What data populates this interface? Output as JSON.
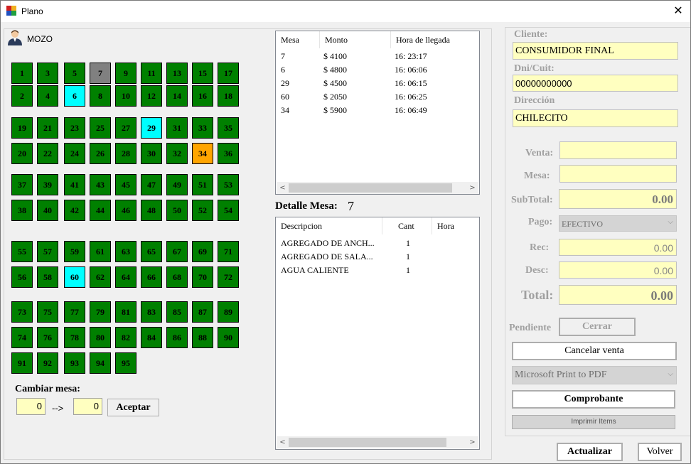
{
  "window": {
    "title": "Plano",
    "close_glyph": "✕",
    "icon": "app-icon"
  },
  "mozo": {
    "label": "MOZO",
    "icon": "waiter-avatar-icon"
  },
  "tables": [
    {
      "n": "1",
      "s": "g"
    },
    {
      "n": "3",
      "s": "g"
    },
    {
      "n": "5",
      "s": "g"
    },
    {
      "n": "7",
      "s": "x"
    },
    {
      "n": "9",
      "s": "g"
    },
    {
      "n": "11",
      "s": "g"
    },
    {
      "n": "13",
      "s": "g"
    },
    {
      "n": "15",
      "s": "g"
    },
    {
      "n": "17",
      "s": "g"
    },
    {
      "n": "2",
      "s": "g"
    },
    {
      "n": "4",
      "s": "g"
    },
    {
      "n": "6",
      "s": "c"
    },
    {
      "n": "8",
      "s": "g"
    },
    {
      "n": "10",
      "s": "g"
    },
    {
      "n": "12",
      "s": "g"
    },
    {
      "n": "14",
      "s": "g"
    },
    {
      "n": "16",
      "s": "g"
    },
    {
      "n": "18",
      "s": "g"
    },
    {
      "n": "19",
      "s": "g"
    },
    {
      "n": "21",
      "s": "g"
    },
    {
      "n": "23",
      "s": "g"
    },
    {
      "n": "25",
      "s": "g"
    },
    {
      "n": "27",
      "s": "g"
    },
    {
      "n": "29",
      "s": "c"
    },
    {
      "n": "31",
      "s": "g"
    },
    {
      "n": "33",
      "s": "g"
    },
    {
      "n": "35",
      "s": "g"
    },
    {
      "n": "20",
      "s": "g"
    },
    {
      "n": "22",
      "s": "g"
    },
    {
      "n": "24",
      "s": "g"
    },
    {
      "n": "26",
      "s": "g"
    },
    {
      "n": "28",
      "s": "g"
    },
    {
      "n": "30",
      "s": "g"
    },
    {
      "n": "32",
      "s": "g"
    },
    {
      "n": "34",
      "s": "o"
    },
    {
      "n": "36",
      "s": "g"
    },
    {
      "n": "37",
      "s": "g"
    },
    {
      "n": "39",
      "s": "g"
    },
    {
      "n": "41",
      "s": "g"
    },
    {
      "n": "43",
      "s": "g"
    },
    {
      "n": "45",
      "s": "g"
    },
    {
      "n": "47",
      "s": "g"
    },
    {
      "n": "49",
      "s": "g"
    },
    {
      "n": "51",
      "s": "g"
    },
    {
      "n": "53",
      "s": "g"
    },
    {
      "n": "38",
      "s": "g"
    },
    {
      "n": "40",
      "s": "g"
    },
    {
      "n": "42",
      "s": "g"
    },
    {
      "n": "44",
      "s": "g"
    },
    {
      "n": "46",
      "s": "g"
    },
    {
      "n": "48",
      "s": "g"
    },
    {
      "n": "50",
      "s": "g"
    },
    {
      "n": "52",
      "s": "g"
    },
    {
      "n": "54",
      "s": "g"
    },
    {
      "n": "55",
      "s": "g"
    },
    {
      "n": "57",
      "s": "g"
    },
    {
      "n": "59",
      "s": "g"
    },
    {
      "n": "61",
      "s": "g"
    },
    {
      "n": "63",
      "s": "g"
    },
    {
      "n": "65",
      "s": "g"
    },
    {
      "n": "67",
      "s": "g"
    },
    {
      "n": "69",
      "s": "g"
    },
    {
      "n": "71",
      "s": "g"
    },
    {
      "n": "56",
      "s": "g"
    },
    {
      "n": "58",
      "s": "g"
    },
    {
      "n": "60",
      "s": "c"
    },
    {
      "n": "62",
      "s": "g"
    },
    {
      "n": "64",
      "s": "g"
    },
    {
      "n": "66",
      "s": "g"
    },
    {
      "n": "68",
      "s": "g"
    },
    {
      "n": "70",
      "s": "g"
    },
    {
      "n": "72",
      "s": "g"
    },
    {
      "n": "73",
      "s": "g"
    },
    {
      "n": "75",
      "s": "g"
    },
    {
      "n": "77",
      "s": "g"
    },
    {
      "n": "79",
      "s": "g"
    },
    {
      "n": "81",
      "s": "g"
    },
    {
      "n": "83",
      "s": "g"
    },
    {
      "n": "85",
      "s": "g"
    },
    {
      "n": "87",
      "s": "g"
    },
    {
      "n": "89",
      "s": "g"
    },
    {
      "n": "74",
      "s": "g"
    },
    {
      "n": "76",
      "s": "g"
    },
    {
      "n": "78",
      "s": "g"
    },
    {
      "n": "80",
      "s": "g"
    },
    {
      "n": "82",
      "s": "g"
    },
    {
      "n": "84",
      "s": "g"
    },
    {
      "n": "86",
      "s": "g"
    },
    {
      "n": "88",
      "s": "g"
    },
    {
      "n": "90",
      "s": "g"
    },
    {
      "n": "91",
      "s": "g"
    },
    {
      "n": "92",
      "s": "g"
    },
    {
      "n": "93",
      "s": "g"
    },
    {
      "n": "94",
      "s": "g"
    },
    {
      "n": "95",
      "s": "g"
    }
  ],
  "table_colors": {
    "g": "#008000",
    "x": "#808080",
    "c": "#00ffff",
    "o": "#ffa500"
  },
  "cambiar": {
    "title": "Cambiar mesa:",
    "from": "0",
    "arrow": "-->",
    "to": "0",
    "accept": "Aceptar"
  },
  "active_grid": {
    "headers": [
      "Mesa",
      "Monto",
      "Hora de llegada"
    ],
    "rows": [
      [
        "7",
        "$ 4100",
        "16: 23:17"
      ],
      [
        "6",
        "$ 4800",
        "16: 06:06"
      ],
      [
        "29",
        "$ 4500",
        "16: 06:15"
      ],
      [
        "60",
        "$ 2050",
        "16: 06:25"
      ],
      [
        "34",
        "$ 5900",
        "16: 06:49"
      ]
    ]
  },
  "detalle": {
    "label": "Detalle Mesa:",
    "mesa": "7"
  },
  "detail_grid": {
    "headers": [
      "Descripcion",
      "Cant",
      "Hora"
    ],
    "rows": [
      [
        "AGREGADO DE ANCH...",
        "1",
        ""
      ],
      [
        "AGREGADO DE SALA...",
        "1",
        ""
      ],
      [
        "AGUA CALIENTE",
        "1",
        ""
      ]
    ]
  },
  "sidebar": {
    "cliente_label": "Cliente:",
    "cliente": "CONSUMIDOR FINAL",
    "dni_label": "Dni/Cuit:",
    "dni": "00000000000",
    "dir_label": "Dirección",
    "dir": "CHILECITO",
    "venta_label": "Venta:",
    "venta": "",
    "mesa_label": "Mesa:",
    "mesa": "",
    "subtotal_label": "SubTotal:",
    "subtotal": "0.00",
    "pago_label": "Pago:",
    "pago": "EFECTIVO",
    "rec_label": "Rec:",
    "rec": "0.00",
    "desc_label": "Desc:",
    "desc": "0.00",
    "total_label": "Total:",
    "total": "0.00",
    "pendiente": "Pendiente",
    "cerrar": "Cerrar",
    "cancelar": "Cancelar venta",
    "printer": "Microsoft Print to PDF",
    "comprobante": "Comprobante",
    "imprimir": "Imprimir Items"
  },
  "footer": {
    "actualizar": "Actualizar",
    "volver": "Volver"
  }
}
